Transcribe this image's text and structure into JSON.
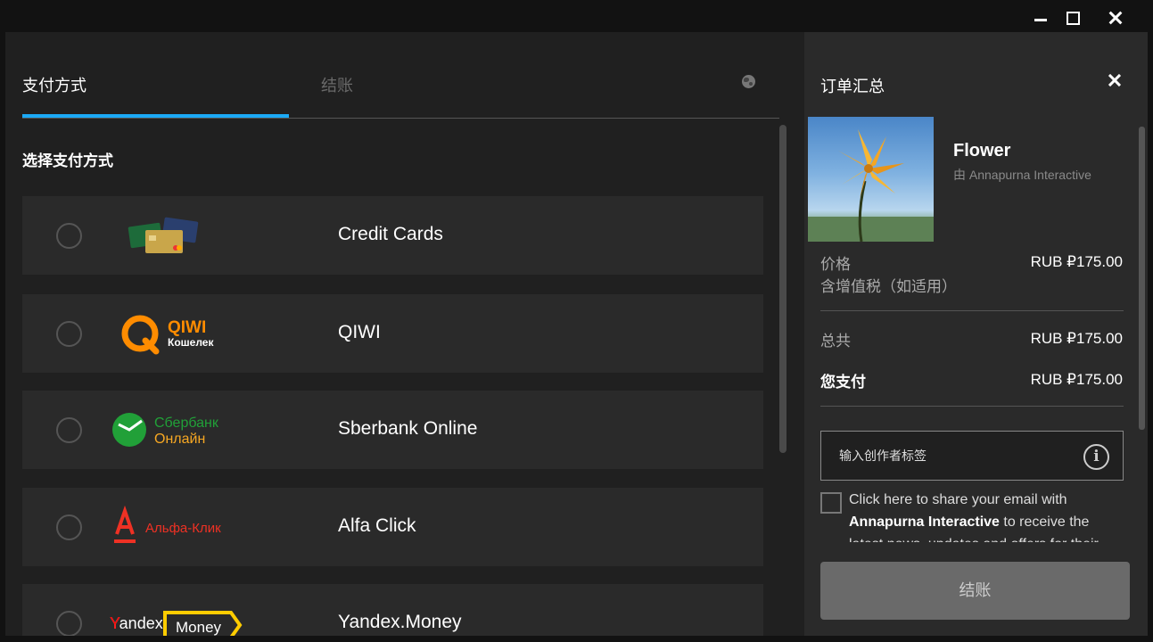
{
  "window": {
    "controls": [
      "minimize",
      "maximize",
      "close"
    ]
  },
  "tabs": [
    {
      "label": "支付方式",
      "active": true
    },
    {
      "label": "结账",
      "active": false
    }
  ],
  "section_title": "选择支付方式",
  "payment_methods": [
    {
      "label": "Credit Cards",
      "logo": "credit-cards-logo"
    },
    {
      "label": "QIWI",
      "logo": "qiwi-logo",
      "logo_text": "QIWI",
      "logo_sub": "Кошелек"
    },
    {
      "label": "Sberbank Online",
      "logo": "sberbank-logo",
      "logo_text": "Сбербанк",
      "logo_sub": "Онлайн"
    },
    {
      "label": "Alfa Click",
      "logo": "alfa-logo",
      "logo_text": "Альфа-Клик"
    },
    {
      "label": "Yandex.Money",
      "logo": "yandex-money-logo",
      "logo_text": "Yandex",
      "logo_sub": "Money"
    }
  ],
  "order": {
    "title": "订单汇总",
    "game_name": "Flower",
    "publisher": "由 Annapurna Interactive",
    "price_label": "价格",
    "price_value": "RUB ₽175.00",
    "vat_note": "含增值税（如适用）",
    "total_label": "总共",
    "total_value": "RUB ₽175.00",
    "you_pay_label": "您支付",
    "you_pay_value": "RUB ₽175.00",
    "creator_tag_placeholder": "输入创作者标签",
    "share_text_pre": "Click here to share your email with ",
    "share_publisher": "Annapurna Interactive",
    "share_text_post": " to receive the latest news, updates and offers for their",
    "checkout_label": "结账"
  },
  "colors": {
    "accent": "#1ba9f5",
    "qiwi": "#ff8c00",
    "sberbank": "#21a038",
    "alfa": "#ef3124",
    "yandex": "#ffcc00"
  }
}
